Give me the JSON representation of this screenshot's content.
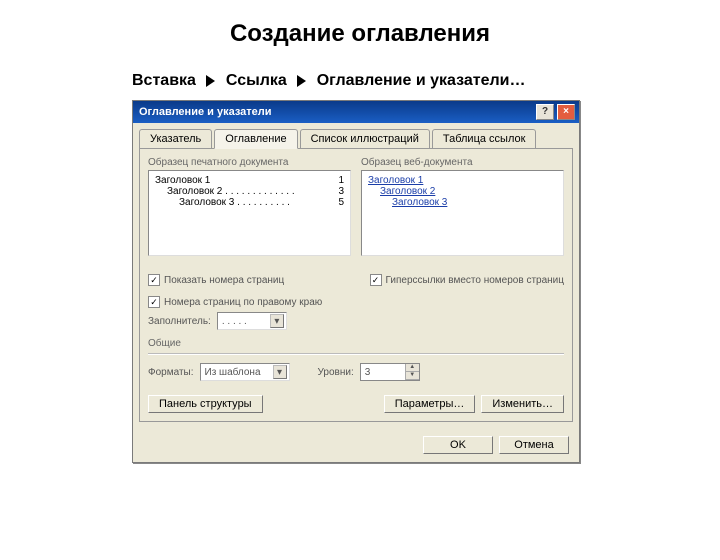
{
  "slide": {
    "title": "Создание оглавления",
    "breadcrumb": [
      "Вставка",
      "Ссылка",
      "Оглавление и указатели…"
    ]
  },
  "dialog": {
    "title": "Оглавление и указатели",
    "help": "?",
    "close": "×",
    "tabs": [
      "Указатель",
      "Оглавление",
      "Список иллюстраций",
      "Таблица ссылок"
    ],
    "activeTab": 1,
    "preview": {
      "printLabel": "Образец печатного документа",
      "webLabel": "Образец веб-документа",
      "lines": [
        {
          "text": "Заголовок 1",
          "indent": 0,
          "page": "1"
        },
        {
          "text": "Заголовок 2",
          "indent": 1,
          "page": "3"
        },
        {
          "text": "Заголовок 3",
          "indent": 2,
          "page": "5"
        }
      ],
      "webLines": [
        {
          "text": "Заголовок 1",
          "indent": 0
        },
        {
          "text": "Заголовок 2",
          "indent": 1
        },
        {
          "text": "Заголовок 3",
          "indent": 2
        }
      ]
    },
    "checks": {
      "showPageNumbers": "Показать номера страниц",
      "rightAlign": "Номера страниц по правому краю",
      "hyperlinks": "Гиперссылки вместо номеров страниц"
    },
    "fillerLabel": "Заполнитель:",
    "fillerValue": ". . . . .",
    "generalLabel": "Общие",
    "formatsLabel": "Форматы:",
    "formatsValue": "Из шаблона",
    "levelsLabel": "Уровни:",
    "levelsValue": "3",
    "panelButton": "Панель структуры",
    "paramsButton": "Параметры…",
    "modifyButton": "Изменить…",
    "okButton": "OK",
    "cancelButton": "Отмена"
  }
}
